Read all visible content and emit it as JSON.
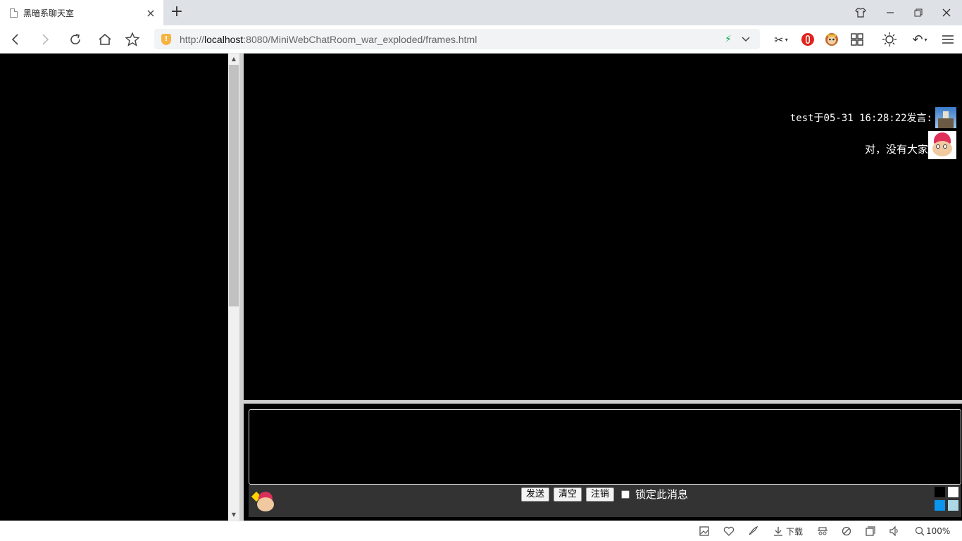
{
  "tab": {
    "title": "黑暗系聊天室",
    "close": "×"
  },
  "newtab": "+",
  "window": {
    "restore": "❐",
    "minimize": "—",
    "maximize": "□",
    "close": "✕",
    "skin": "👕"
  },
  "nav": {
    "back": "‹",
    "forward": "›",
    "reload": "↻",
    "home": "⌂",
    "bookmark": "☆"
  },
  "url": {
    "scheme": "http://",
    "host": "localhost",
    "rest": ":8080/MiniWebChatRoom_war_exploded/frames.html",
    "shield": "!"
  },
  "tools": {
    "cut": "✂",
    "menu": "☰",
    "undo": "↶",
    "theme": "☼",
    "apps": "▦"
  },
  "chat": {
    "header": "test于05-31 16:28:22发言:",
    "message": "对，没有大家"
  },
  "input": {
    "send": "发送",
    "clear": "清空",
    "logout": "注销",
    "lock": "锁定此消息"
  },
  "swatches": [
    "#000000",
    "#ffffff",
    "#0a95f0",
    "#add8e6"
  ],
  "status": {
    "download": "下载",
    "zoom": "100%"
  }
}
